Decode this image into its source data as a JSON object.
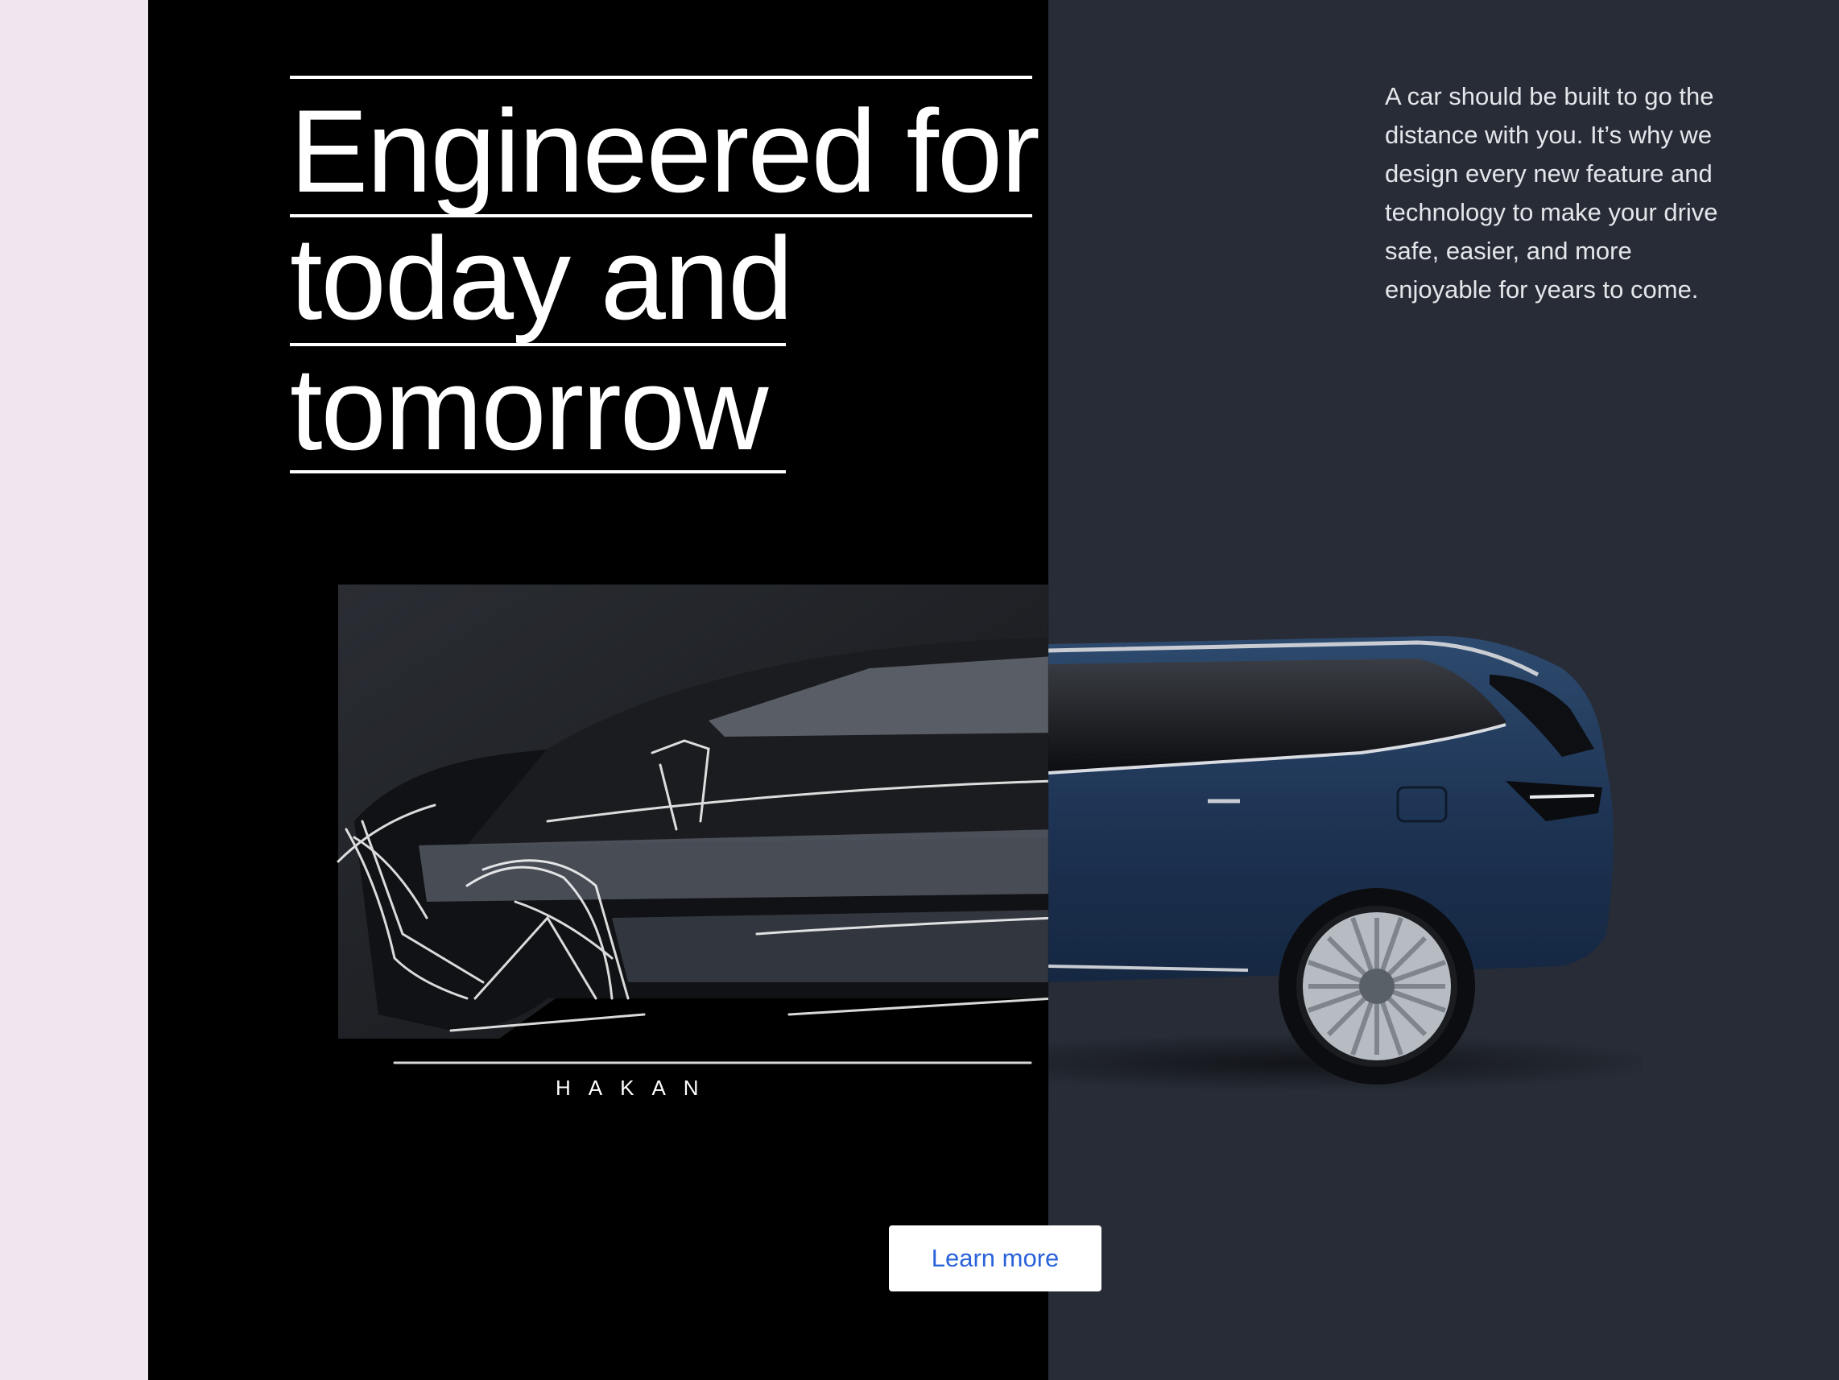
{
  "hero": {
    "headline_lines": [
      "Engineered for",
      "today and",
      "tomorrow"
    ],
    "body": "A car should be built to go the distance with you. It’s why we design every new feature and technology to make your drive safe, easier, and more enjoyable for years to come.",
    "cta_label": "Learn more"
  },
  "image": {
    "sketch_signature": "HAKAN",
    "car_color": "#1f3452"
  },
  "colors": {
    "page_bg": "#f0e6ef",
    "dark_panel": "#000000",
    "slate_panel": "#272c36",
    "cta_text": "#2a63d9"
  }
}
